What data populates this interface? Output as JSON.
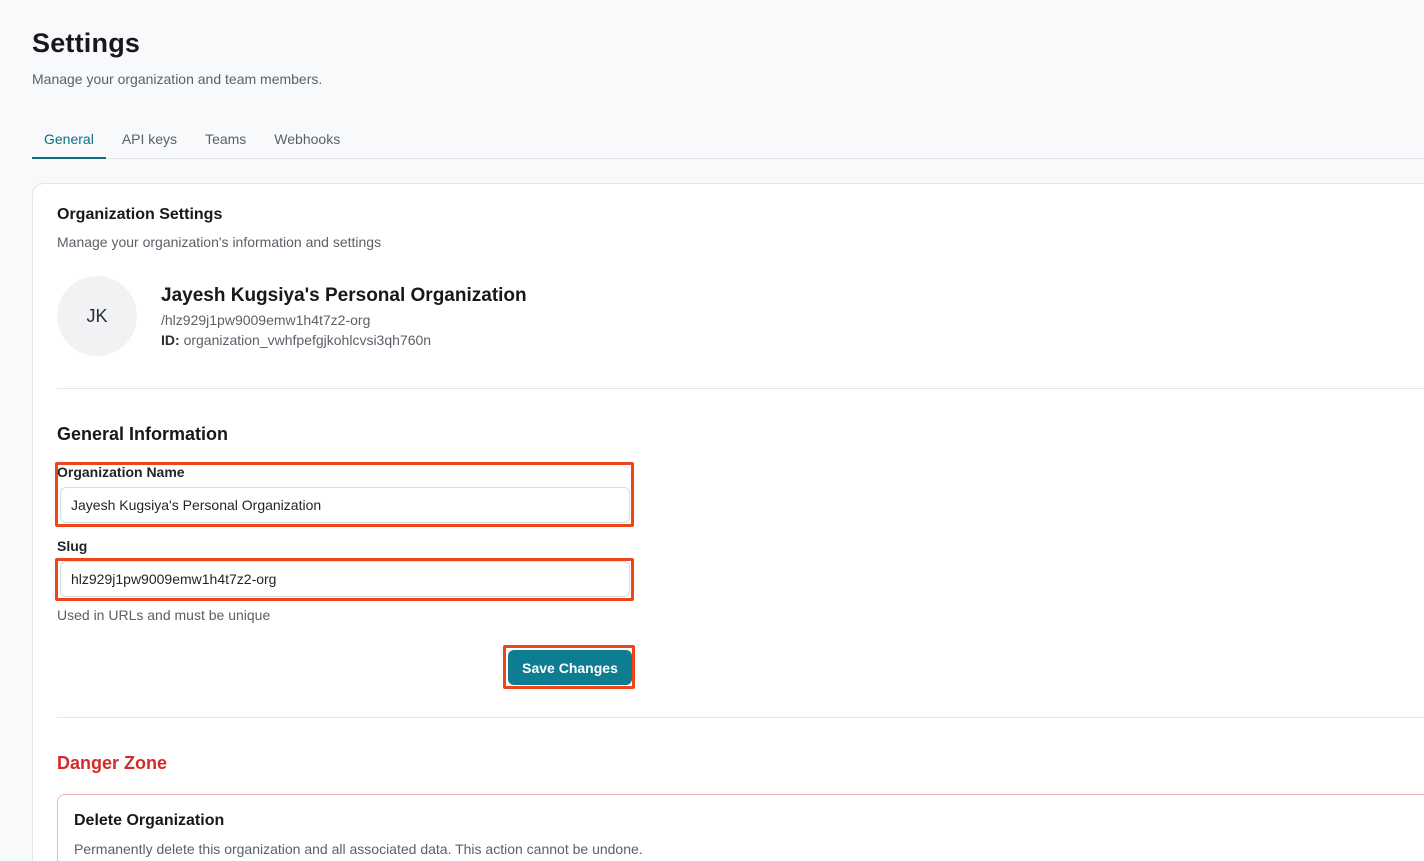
{
  "header": {
    "title": "Settings",
    "subtitle": "Manage your organization and team members."
  },
  "tabs": [
    {
      "label": "General",
      "active": true
    },
    {
      "label": "API keys",
      "active": false
    },
    {
      "label": "Teams",
      "active": false
    },
    {
      "label": "Webhooks",
      "active": false
    }
  ],
  "org_settings": {
    "title": "Organization Settings",
    "description": "Manage your organization's information and settings",
    "avatar_initials": "JK",
    "org_name": "Jayesh Kugsiya's Personal Organization",
    "slug_path": "/hlz929j1pw9009emw1h4t7z2-org",
    "id_label": "ID:",
    "id_value": "organization_vwhfpefgjkohlcvsi3qh760n"
  },
  "general_info": {
    "title": "General Information",
    "org_name_label": "Organization Name",
    "org_name_value": "Jayesh Kugsiya's Personal Organization",
    "slug_label": "Slug",
    "slug_value": "hlz929j1pw9009emw1h4t7z2-org",
    "slug_hint": "Used in URLs and must be unique",
    "save_label": "Save Changes"
  },
  "danger_zone": {
    "title": "Danger Zone",
    "delete_title": "Delete Organization",
    "delete_desc": "Permanently delete this organization and all associated data. This action cannot be undone."
  },
  "colors": {
    "accent": "#0f7d91",
    "highlight": "#f0441b",
    "danger": "#d42a2a"
  }
}
